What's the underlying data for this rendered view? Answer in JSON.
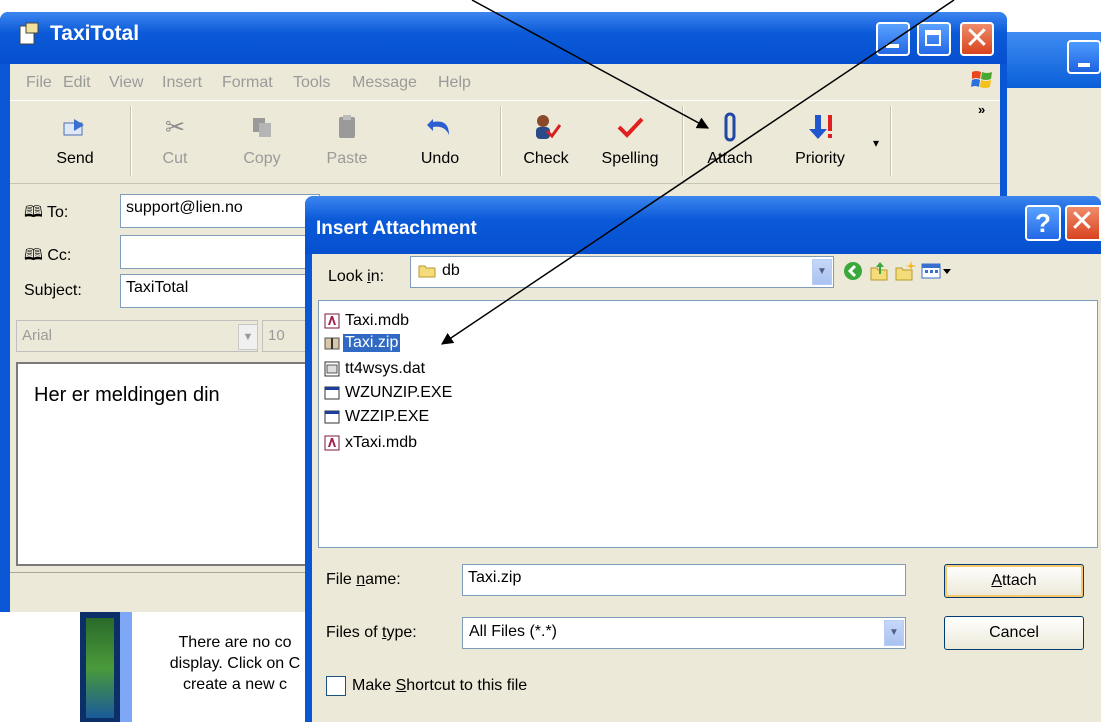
{
  "window": {
    "title": "TaxiTotal",
    "menus": [
      "File",
      "Edit",
      "View",
      "Insert",
      "Format",
      "Tools",
      "Message",
      "Help"
    ]
  },
  "toolbar": {
    "buttons": [
      {
        "label": "Send",
        "icon": "send-icon",
        "enabled": true
      },
      {
        "label": "Cut",
        "icon": "scissors-icon",
        "enabled": false
      },
      {
        "label": "Copy",
        "icon": "copy-icon",
        "enabled": false
      },
      {
        "label": "Paste",
        "icon": "paste-icon",
        "enabled": false
      },
      {
        "label": "Undo",
        "icon": "undo-icon",
        "enabled": true
      },
      {
        "label": "Check",
        "icon": "check-names-icon",
        "enabled": true
      },
      {
        "label": "Spelling",
        "icon": "spelling-icon",
        "enabled": true
      },
      {
        "label": "Attach",
        "icon": "paperclip-icon",
        "enabled": true
      },
      {
        "label": "Priority",
        "icon": "priority-icon",
        "enabled": true
      }
    ],
    "overflow": "»"
  },
  "header": {
    "to_label": "To:",
    "to_value": "support@lien.no",
    "cc_label": "Cc:",
    "cc_value": "",
    "subject_label": "Subject:",
    "subject_value": "TaxiTotal"
  },
  "format": {
    "font": "Arial",
    "size": "10"
  },
  "message": {
    "body": "Her er meldingen din"
  },
  "contacts_pane": {
    "line1": "There are no co",
    "line2": "display. Click on C",
    "line3": "create a new c"
  },
  "dialog": {
    "title": "Insert Attachment",
    "look_in_label_pre": "Look ",
    "look_in_label_ul": "i",
    "look_in_label_post": "n:",
    "look_in_value": "db",
    "files": [
      {
        "name": "Taxi.mdb",
        "icon": "access-db-icon",
        "selected": false
      },
      {
        "name": "Taxi.zip",
        "icon": "zip-archive-icon",
        "selected": true
      },
      {
        "name": "tt4wsys.dat",
        "icon": "data-file-icon",
        "selected": false
      },
      {
        "name": "WZUNZIP.EXE",
        "icon": "executable-icon",
        "selected": false
      },
      {
        "name": "WZZIP.EXE",
        "icon": "executable-icon",
        "selected": false
      },
      {
        "name": "xTaxi.mdb",
        "icon": "access-db-icon",
        "selected": false
      }
    ],
    "file_name_label_pre": "File ",
    "file_name_label_ul": "n",
    "file_name_label_post": "ame:",
    "file_name_value": "Taxi.zip",
    "file_type_label_pre": "Files of ",
    "file_type_label_ul": "t",
    "file_type_label_post": "ype:",
    "file_type_value": "All Files (*.*)",
    "attach_pre": "",
    "attach_ul": "A",
    "attach_post": "ttach",
    "cancel_label": "Cancel",
    "shortcut_pre": "Make ",
    "shortcut_ul": "S",
    "shortcut_post": "hortcut to this file",
    "shortcut_checked": false
  },
  "colors": {
    "xp_blue": "#0a57d6",
    "selection": "#316ac5",
    "dialog_face": "#ece9d8"
  }
}
